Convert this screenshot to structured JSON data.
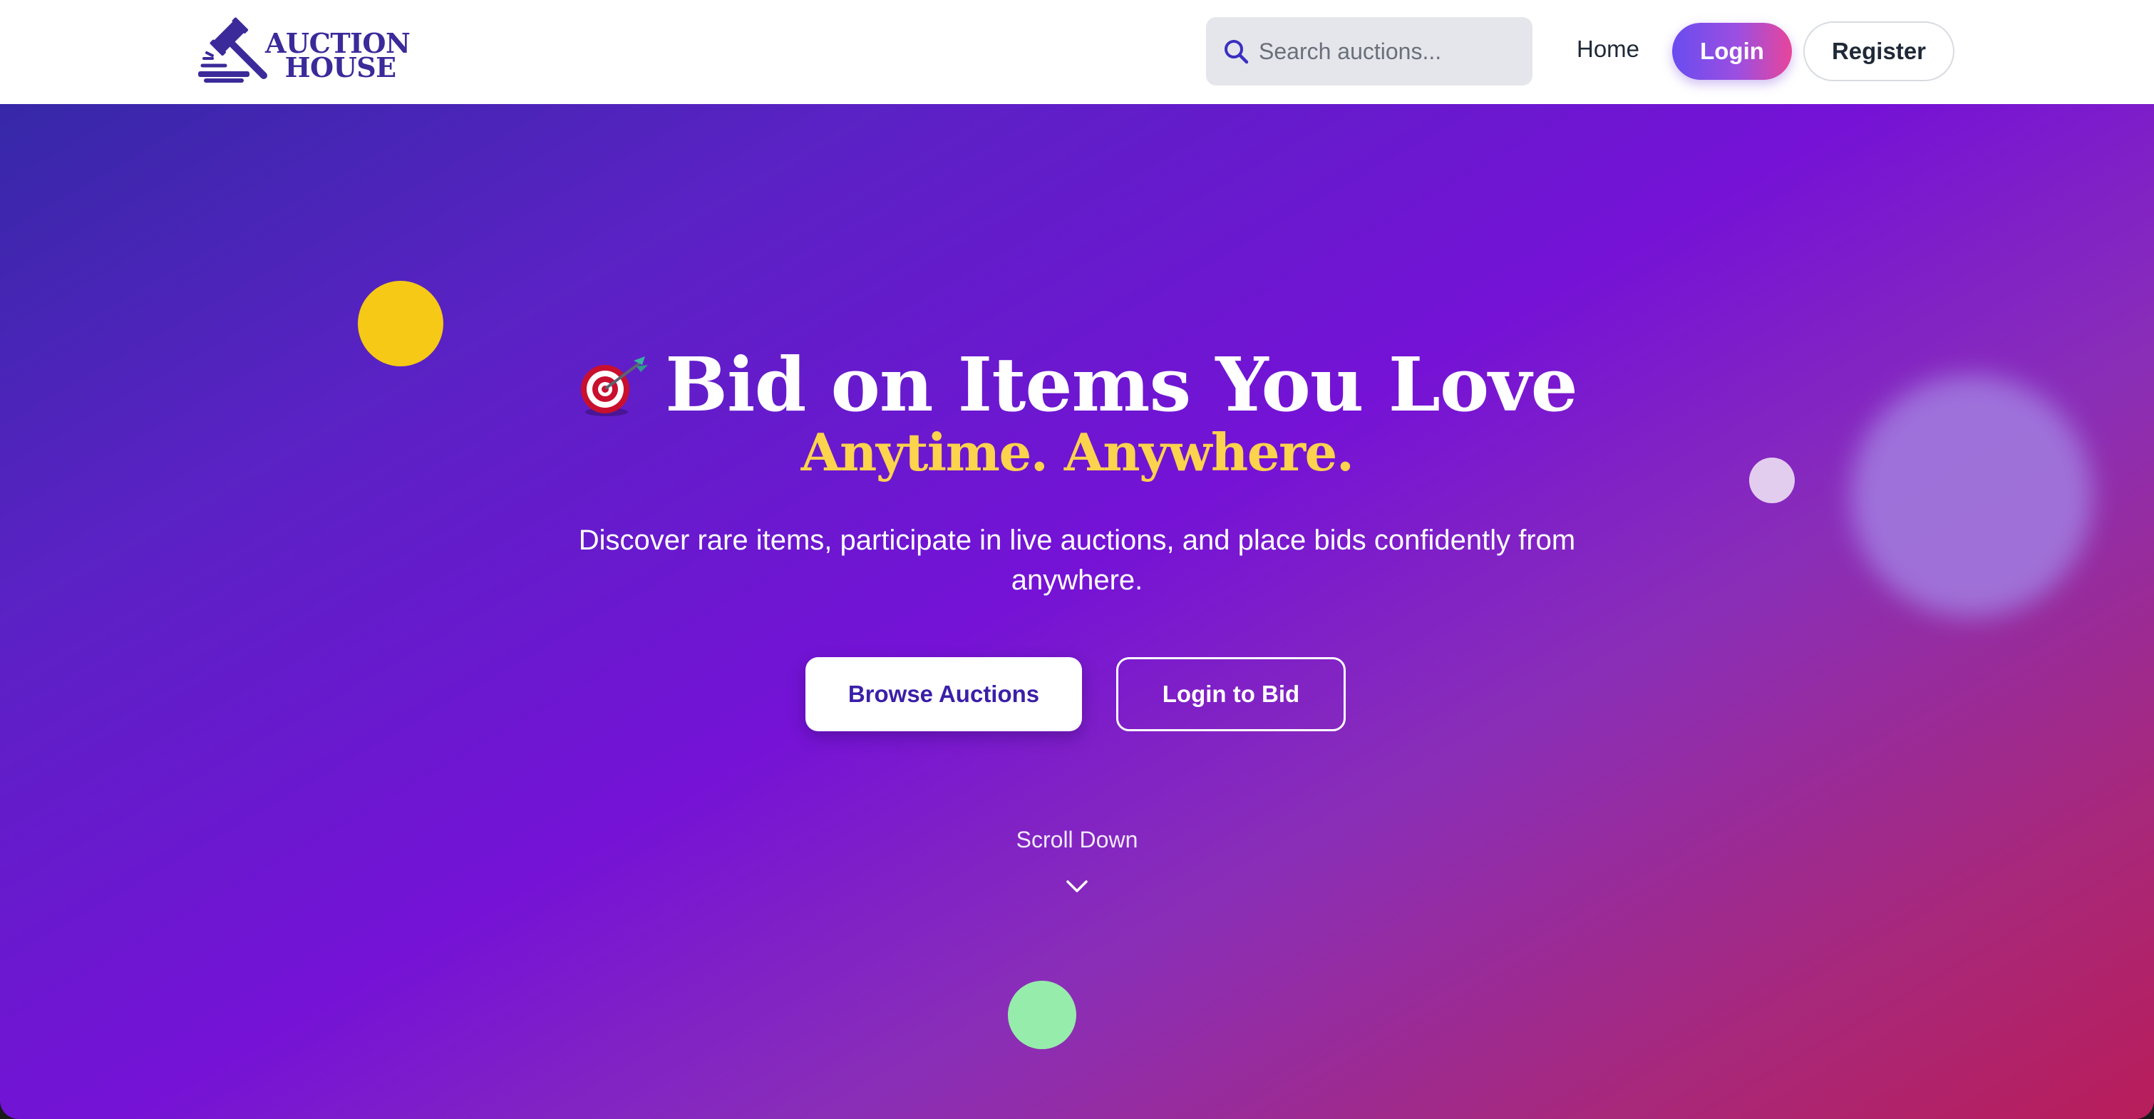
{
  "nav": {
    "logo_line1": "AUCTION",
    "logo_line2": "HOUSE",
    "search_placeholder": "Search auctions...",
    "home_label": "Home",
    "login_label": "Login",
    "register_label": "Register"
  },
  "hero": {
    "title": "Bid on Items You Love",
    "title_icon": "dart-target-emoji",
    "subtitle": "Anytime. Anywhere.",
    "description": "Discover rare items, participate in live auctions, and place bids confidently from anywhere.",
    "browse_label": "Browse Auctions",
    "login_bid_label": "Login to Bid",
    "scroll_label": "Scroll Down"
  },
  "colors": {
    "brand": "#3b2a9a",
    "accent_yellow": "#fbd34d",
    "gradient_start": "#3628a8",
    "gradient_mid": "#7512d6",
    "gradient_end": "#b81d5a",
    "login_gradient_start": "#6a4cf0",
    "login_gradient_end": "#e8459a"
  },
  "icons": {
    "logo": "gavel-icon",
    "search": "search-icon",
    "scroll": "chevron-down-icon"
  }
}
